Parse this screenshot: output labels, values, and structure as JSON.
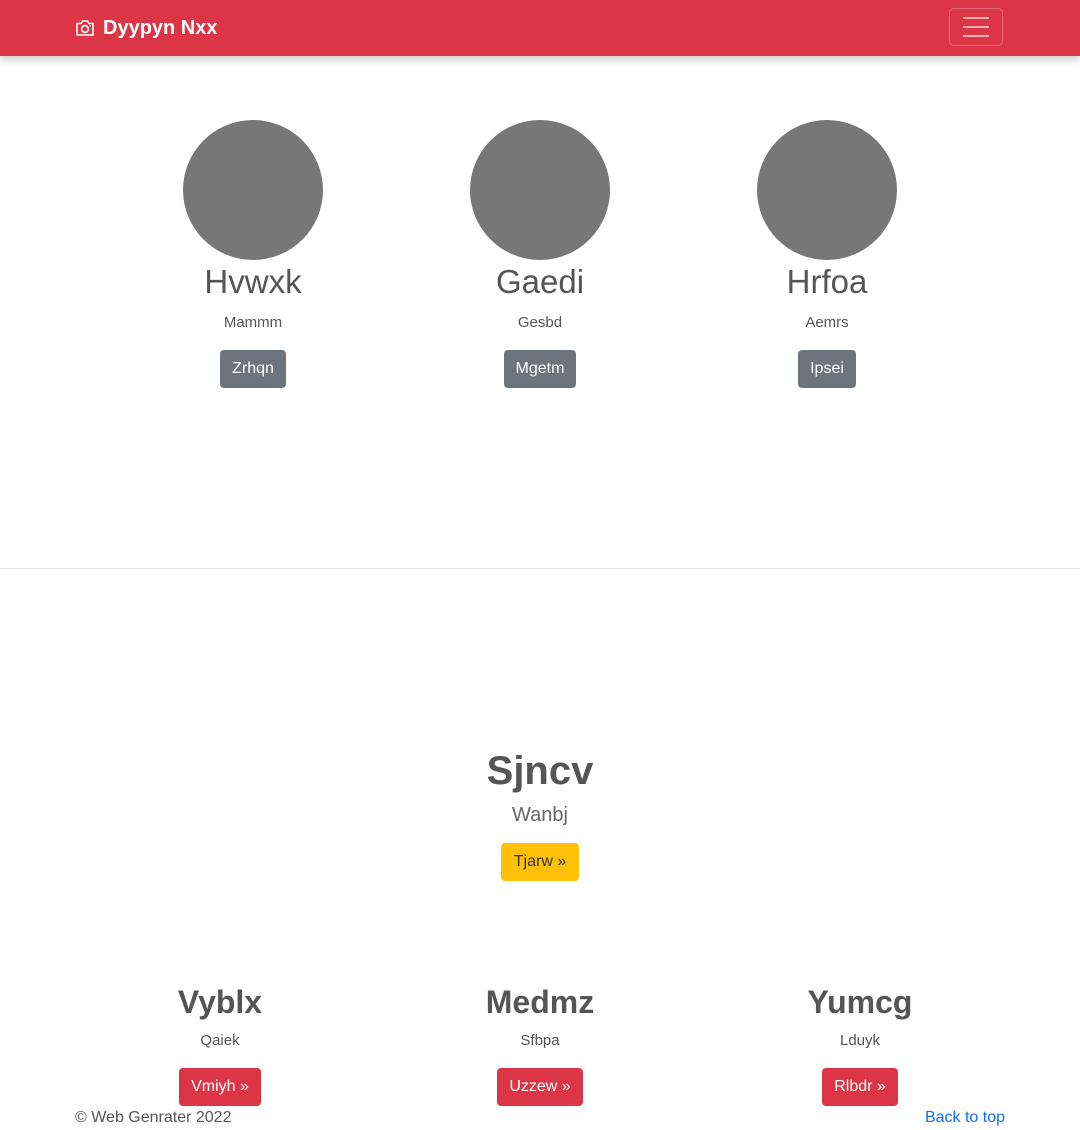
{
  "navbar": {
    "brand_icon": "camera-icon",
    "brand_text": "Dyypyn Nxx",
    "menu_icon": "hamburger-menu-icon",
    "color": "#dc3545"
  },
  "team": [
    {
      "name": "Hvwxk",
      "role": "Mammm",
      "button": "Zrhqn"
    },
    {
      "name": "Gaedi",
      "role": "Gesbd",
      "button": "Mgetm"
    },
    {
      "name": "Hrfoa",
      "role": "Aemrs",
      "button": "Ipsei"
    }
  ],
  "hero": {
    "title": "Sjncv",
    "subtitle": "Wanbj",
    "button": "Tjarw »",
    "button_color": "#ffc107"
  },
  "features": [
    {
      "title": "Vyblx",
      "subtitle": "Qaiek",
      "button": "Vmiyh »"
    },
    {
      "title": "Medmz",
      "subtitle": "Sfbpa",
      "button": "Uzzew »"
    },
    {
      "title": "Yumcg",
      "subtitle": "Lduyk",
      "button": "Rlbdr »"
    }
  ],
  "footer": {
    "copyright": "© Web Genrater 2022",
    "back_to_top": "Back to top"
  }
}
